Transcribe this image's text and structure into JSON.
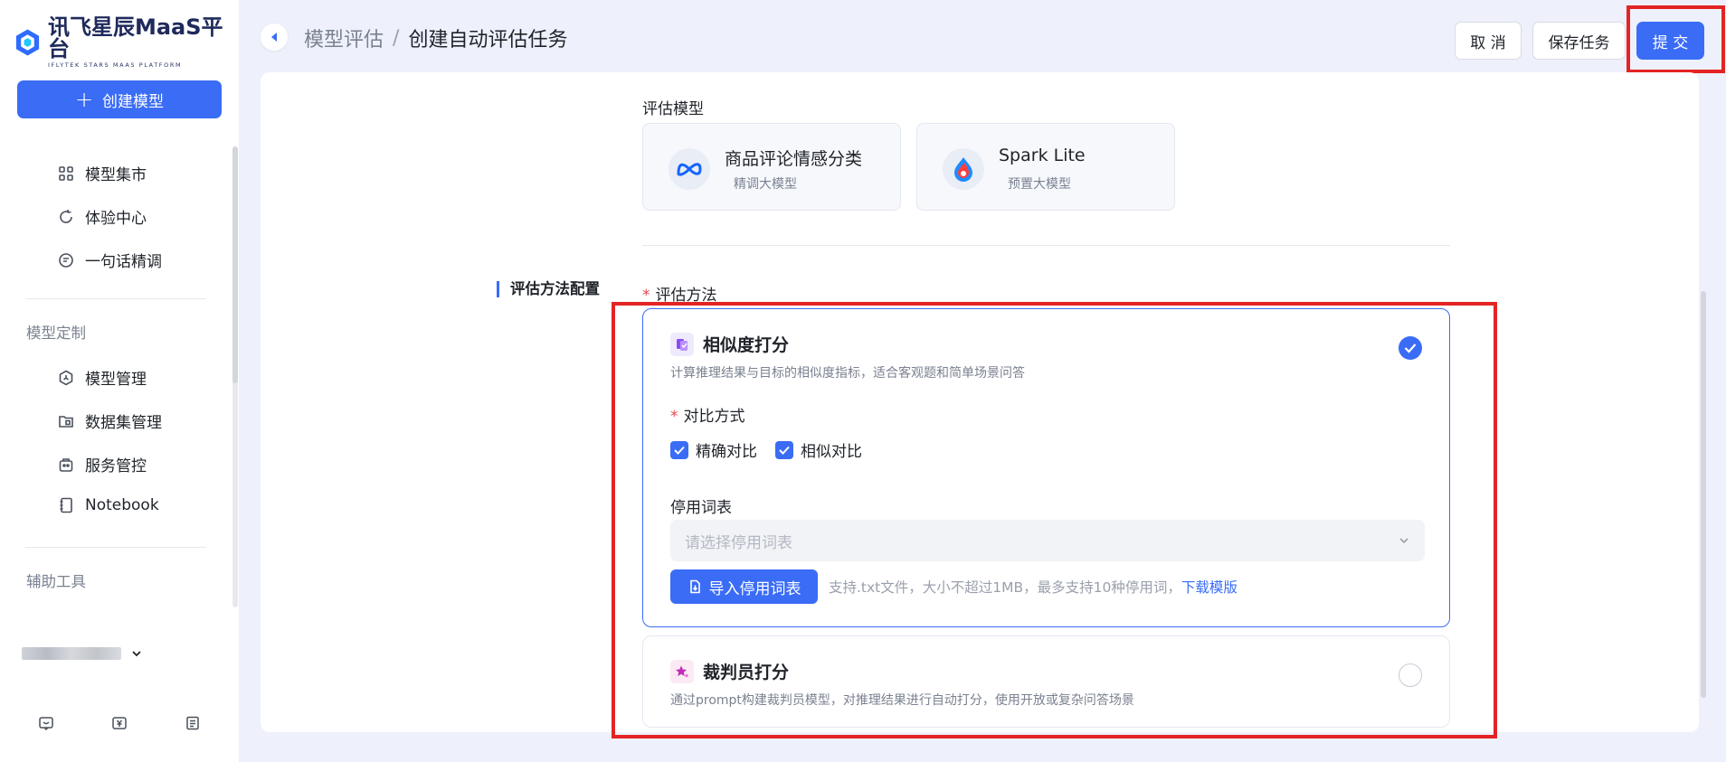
{
  "brand": {
    "name": "讯飞星辰MaaS平台",
    "subtitle": "IFLYTEK STARS MAAS PLATFORM"
  },
  "sidebar": {
    "create_label": "创建模型",
    "items_top": [
      {
        "label": "模型集市",
        "icon": "grid-icon"
      },
      {
        "label": "体验中心",
        "icon": "refresh-icon"
      },
      {
        "label": "一句话精调",
        "icon": "chat-tune-icon"
      }
    ],
    "group_custom": "模型定制",
    "items_custom": [
      {
        "label": "模型管理",
        "icon": "hexagon-icon"
      },
      {
        "label": "数据集管理",
        "icon": "dataset-icon"
      },
      {
        "label": "服务管控",
        "icon": "service-icon"
      },
      {
        "label": "Notebook",
        "icon": "notebook-icon"
      }
    ],
    "group_tools": "辅助工具"
  },
  "header": {
    "breadcrumb_parent": "模型评估",
    "breadcrumb_sep": "/",
    "breadcrumb_current": "创建自动评估任务",
    "cancel_label": "取 消",
    "save_label": "保存任务",
    "submit_label": "提 交"
  },
  "form": {
    "eval_model_label": "评估模型",
    "models": [
      {
        "name": "商品评论情感分类",
        "type": "精调大模型",
        "icon": "meta-icon"
      },
      {
        "name": "Spark Lite",
        "type": "预置大模型",
        "icon": "spark-icon"
      }
    ],
    "section_title": "评估方法配置",
    "method_label": "评估方法",
    "required_mark": "*",
    "methods": [
      {
        "title": "相似度打分",
        "desc": "计算推理结果与目标的相似度指标，适合客观题和简单场景问答",
        "selected": true,
        "compare_label": "对比方式",
        "compare_options": [
          {
            "label": "精确对比",
            "checked": true
          },
          {
            "label": "相似对比",
            "checked": true
          }
        ],
        "stopword_label": "停用词表",
        "stopword_placeholder": "请选择停用词表",
        "import_label": "导入停用词表",
        "import_tip": "支持.txt文件，大小不超过1MB，最多支持10种停用词，",
        "download_label": "下载模版"
      },
      {
        "title": "裁判员打分",
        "desc": "通过prompt构建裁判员模型，对推理结果进行自动打分，使用开放或复杂问答场景",
        "selected": false
      }
    ]
  },
  "colors": {
    "primary": "#3a6cf6",
    "highlight": "#e42424",
    "background": "#eef1fb"
  }
}
